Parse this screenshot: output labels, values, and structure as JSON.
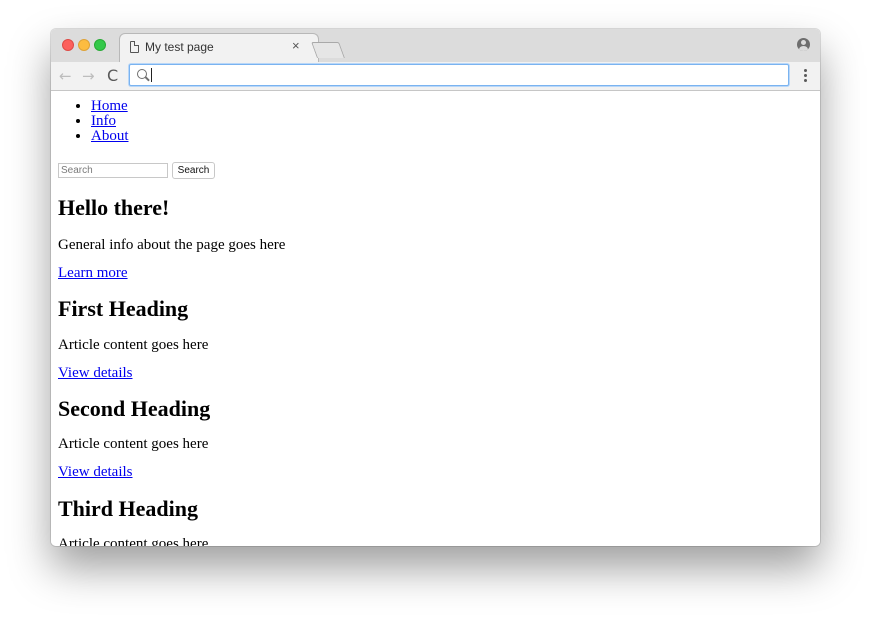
{
  "browser": {
    "tab_title": "My test page",
    "tab_close": "×",
    "address_value": "",
    "nav_back": "←",
    "nav_forward": "→",
    "nav_reload": "C"
  },
  "page": {
    "nav": [
      "Home",
      "Info",
      "About"
    ],
    "search": {
      "placeholder": "Search",
      "button_label": "Search"
    },
    "hero": {
      "heading": "Hello there!",
      "text": "General info about the page goes here",
      "link": "Learn more"
    },
    "articles": [
      {
        "heading": "First Heading",
        "text": "Article content goes here",
        "link": "View details"
      },
      {
        "heading": "Second Heading",
        "text": "Article content goes here",
        "link": "View details"
      },
      {
        "heading": "Third Heading",
        "text": "Article content goes here"
      }
    ]
  },
  "colors": {
    "link": "#0000ee",
    "titlebar": "#dcdcdc",
    "omnibox_focus": "#7ab3f0"
  }
}
